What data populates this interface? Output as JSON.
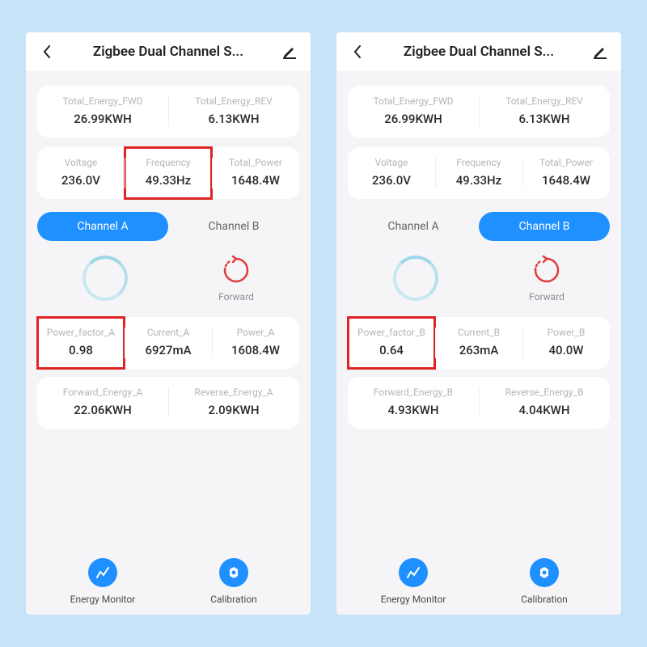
{
  "left": {
    "title": "Zigbee Dual Channel S...",
    "totals": {
      "fwd_label": "Total_Energy_FWD",
      "fwd_value": "26.99KWH",
      "rev_label": "Total_Energy_REV",
      "rev_value": "6.13KWH"
    },
    "triple": {
      "voltage_label": "Voltage",
      "voltage_value": "236.0V",
      "freq_label": "Frequency",
      "freq_value": "49.33Hz",
      "power_label": "Total_Power",
      "power_value": "1648.4W"
    },
    "tabs": {
      "a": "Channel A",
      "b": "Channel B",
      "active": "a"
    },
    "direction": "Forward",
    "metrics": {
      "pf_label": "Power_factor_A",
      "pf_value": "0.98",
      "current_label": "Current_A",
      "current_value": "6927mA",
      "power_label": "Power_A",
      "power_value": "1608.4W"
    },
    "energy": {
      "fwd_label": "Forward_Energy_A",
      "fwd_value": "22.06KWH",
      "rev_label": "Reverse_Energy_A",
      "rev_value": "2.09KWH"
    },
    "bottom": {
      "monitor": "Energy Monitor",
      "calib": "Calibration"
    },
    "highlight_freq": true
  },
  "right": {
    "title": "Zigbee Dual Channel S...",
    "totals": {
      "fwd_label": "Total_Energy_FWD",
      "fwd_value": "26.99KWH",
      "rev_label": "Total_Energy_REV",
      "rev_value": "6.13KWH"
    },
    "triple": {
      "voltage_label": "Voltage",
      "voltage_value": "236.0V",
      "freq_label": "Frequency",
      "freq_value": "49.33Hz",
      "power_label": "Total_Power",
      "power_value": "1648.4W"
    },
    "tabs": {
      "a": "Channel A",
      "b": "Channel B",
      "active": "b"
    },
    "direction": "Forward",
    "metrics": {
      "pf_label": "Power_factor_B",
      "pf_value": "0.64",
      "current_label": "Current_B",
      "current_value": "263mA",
      "power_label": "Power_B",
      "power_value": "40.0W"
    },
    "energy": {
      "fwd_label": "Forward_Energy_B",
      "fwd_value": "4.93KWH",
      "rev_label": "Reverse_Energy_B",
      "rev_value": "4.04KWH"
    },
    "bottom": {
      "monitor": "Energy Monitor",
      "calib": "Calibration"
    },
    "highlight_freq": false
  }
}
